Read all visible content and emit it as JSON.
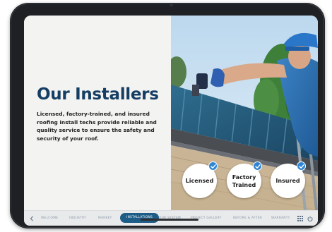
{
  "page": {
    "title": "Our Installers",
    "description": "Licensed, factory-trained, and insured roofing install techs provide reliable and quality service to ensure the safety and security of your roof."
  },
  "badges": [
    {
      "label": "Licensed",
      "icon": "check-icon"
    },
    {
      "label": "Factory\nTrained",
      "icon": "check-icon"
    },
    {
      "label": "Insured",
      "icon": "check-icon"
    }
  ],
  "nav": {
    "items": [
      "WELCOME",
      "INDUSTRY",
      "MARKET",
      "INSTALLATIONS",
      "OUR SYSTEM",
      "PROJECT GALLERY",
      "BEFORE & AFTER",
      "WARRANTY"
    ],
    "active": "INSTALLATIONS",
    "icons": [
      "chevron-left-icon",
      "grid-icon",
      "power-icon"
    ]
  },
  "colors": {
    "title": "#163e63",
    "nav_active": "#1d5c86",
    "check": "#2f86d6",
    "device": "#1e2023"
  }
}
